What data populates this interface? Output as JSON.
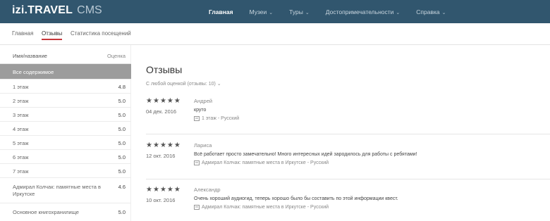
{
  "header": {
    "brand_main": "izi.TRAVEL",
    "brand_sub": "CMS",
    "nav": [
      {
        "label": "Главная",
        "active": true
      },
      {
        "label": "Музеи",
        "dropdown": true
      },
      {
        "label": "Туры",
        "dropdown": true
      },
      {
        "label": "Достопримечательности",
        "dropdown": true
      },
      {
        "label": "Справка",
        "dropdown": true
      }
    ]
  },
  "subnav": {
    "tabs": [
      {
        "label": "Главная"
      },
      {
        "label": "Отзывы",
        "active": true
      },
      {
        "label": "Статистика посещений"
      }
    ]
  },
  "sidebar": {
    "header_name": "Имя/название",
    "header_rating": "Оценка",
    "items": [
      {
        "label": "Все содержимое",
        "value": "",
        "selected": true
      },
      {
        "label": "1 этаж",
        "value": "4.8"
      },
      {
        "label": "2 этаж",
        "value": "5.0"
      },
      {
        "label": "3 этаж",
        "value": "5.0"
      },
      {
        "label": "4 этаж",
        "value": "5.0"
      },
      {
        "label": "5 этаж",
        "value": "5.0"
      },
      {
        "label": "6 этаж",
        "value": "5.0"
      },
      {
        "label": "7 этаж",
        "value": "5.0"
      },
      {
        "label": "Адмирал Колчак: памятные места в Иркутске",
        "value": "4.6"
      },
      {
        "label": "Основное книгохранилище",
        "value": "5.0"
      }
    ]
  },
  "main": {
    "title": "Отзывы",
    "filter": "С любой оценкой (отзывы: 10) ⌄",
    "reviews": [
      {
        "stars": 5,
        "date": "04 дек. 2016",
        "author": "Андрей",
        "text": "круто",
        "source": "1 этаж - Русский"
      },
      {
        "stars": 5,
        "date": "12 окт. 2016",
        "author": "Лариса",
        "text": "Всё работает просто замечательно! Много интересных идей зародилось для работы с ребятами!",
        "source": "Адмирал Колчак: памятные места в Иркутске - Русский"
      },
      {
        "stars": 5,
        "date": "10 окт. 2016",
        "author": "Александр",
        "text": "Очень хороший аудиогид, теперь хорошо было бы составить по этой информации квест.",
        "source": "Адмирал Колчак: памятные места в Иркутске - Русский"
      }
    ]
  },
  "colors": {
    "topbar": "#31566e",
    "active_tab_underline": "#c7373b",
    "selected_row": "#9c9c9c"
  }
}
